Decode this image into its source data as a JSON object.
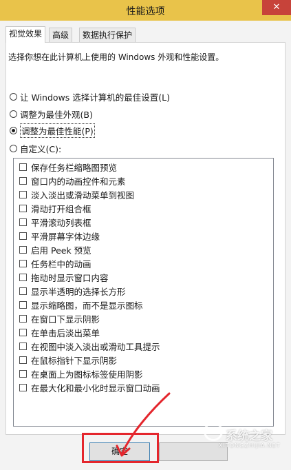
{
  "window": {
    "title": "性能选项",
    "close_glyph": "✕"
  },
  "tabs": [
    {
      "label": "视觉效果",
      "active": true
    },
    {
      "label": "高级",
      "active": false
    },
    {
      "label": "数据执行保护",
      "active": false
    }
  ],
  "description": "选择你想在此计算机上使用的 Windows 外观和性能设置。",
  "radio_options": [
    {
      "label": "让 Windows 选择计算机的最佳设置(L)",
      "checked": false
    },
    {
      "label": "调整为最佳外观(B)",
      "checked": false
    },
    {
      "label": "调整为最佳性能(P)",
      "checked": true
    },
    {
      "label": "自定义(C):",
      "checked": false
    }
  ],
  "effects": [
    {
      "label": "保存任务栏缩略图预览",
      "checked": false
    },
    {
      "label": "窗口内的动画控件和元素",
      "checked": false
    },
    {
      "label": "淡入淡出或滑动菜单到视图",
      "checked": false
    },
    {
      "label": "滑动打开组合框",
      "checked": false
    },
    {
      "label": "平滑滚动列表框",
      "checked": false
    },
    {
      "label": "平滑屏幕字体边缘",
      "checked": false
    },
    {
      "label": "启用 Peek 预览",
      "checked": false
    },
    {
      "label": "任务栏中的动画",
      "checked": false
    },
    {
      "label": "拖动时显示窗口内容",
      "checked": false
    },
    {
      "label": "显示半透明的选择长方形",
      "checked": false
    },
    {
      "label": "显示缩略图，而不是显示图标",
      "checked": false
    },
    {
      "label": "在窗口下显示阴影",
      "checked": false
    },
    {
      "label": "在单击后淡出菜单",
      "checked": false
    },
    {
      "label": "在视图中淡入淡出或滑动工具提示",
      "checked": false
    },
    {
      "label": "在鼠标指针下显示阴影",
      "checked": false
    },
    {
      "label": "在桌面上为图标标签使用阴影",
      "checked": false
    },
    {
      "label": "在最大化和最小化时显示窗口动画",
      "checked": false
    }
  ],
  "buttons": {
    "ok": "确定"
  },
  "watermark": {
    "text": "系统之家",
    "sub": "XITONGZHIJIA.NET"
  },
  "colors": {
    "titlebar": "#e9c34a",
    "close": "#c7433a",
    "annotation": "#e4262d"
  }
}
